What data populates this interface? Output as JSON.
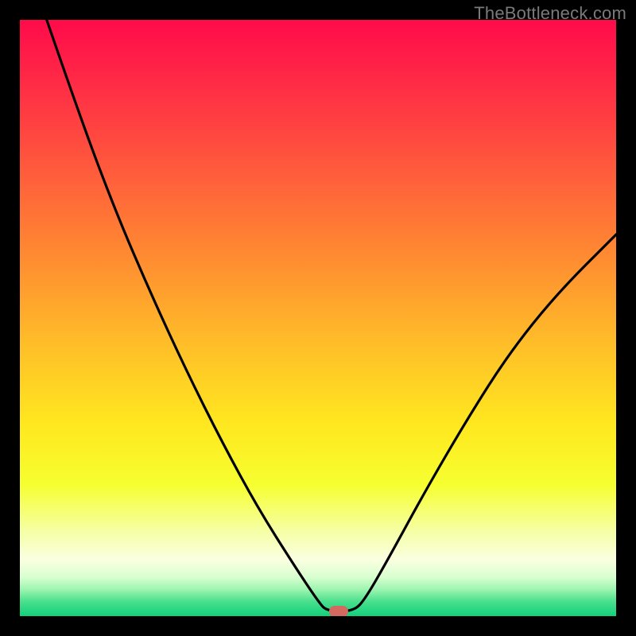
{
  "watermark": "TheBottleneck.com",
  "marker": {
    "color": "#d46a5f",
    "x_pct": 53.5,
    "y_pct": 99.2
  },
  "gradient_stops": [
    {
      "offset": 0,
      "color": "#ff0b4a"
    },
    {
      "offset": 0.1,
      "color": "#ff2946"
    },
    {
      "offset": 0.25,
      "color": "#ff5a3c"
    },
    {
      "offset": 0.4,
      "color": "#ff8c31"
    },
    {
      "offset": 0.55,
      "color": "#ffc028"
    },
    {
      "offset": 0.68,
      "color": "#ffe81f"
    },
    {
      "offset": 0.78,
      "color": "#f6ff30"
    },
    {
      "offset": 0.86,
      "color": "#f6ffa8"
    },
    {
      "offset": 0.905,
      "color": "#faffe0"
    },
    {
      "offset": 0.935,
      "color": "#d8ffd0"
    },
    {
      "offset": 0.955,
      "color": "#9ef5b0"
    },
    {
      "offset": 0.975,
      "color": "#4be08e"
    },
    {
      "offset": 1.0,
      "color": "#12d07a"
    }
  ],
  "chart_data": {
    "type": "line",
    "title": "",
    "xlabel": "",
    "ylabel": "",
    "xlim": [
      0,
      100
    ],
    "ylim": [
      0,
      100
    ],
    "note": "y axis is inverted visually (0 at top, 100 at bottom). Values below are percentages of plot width (x) and plot height from top (y).",
    "series": [
      {
        "name": "bottleneck-curve",
        "points": [
          {
            "x": 4.5,
            "y": 0.0
          },
          {
            "x": 10.0,
            "y": 16.0
          },
          {
            "x": 16.0,
            "y": 32.0
          },
          {
            "x": 22.0,
            "y": 46.0
          },
          {
            "x": 28.0,
            "y": 59.0
          },
          {
            "x": 34.0,
            "y": 71.0
          },
          {
            "x": 40.0,
            "y": 82.0
          },
          {
            "x": 46.0,
            "y": 91.5
          },
          {
            "x": 50.0,
            "y": 97.5
          },
          {
            "x": 51.5,
            "y": 99.2
          },
          {
            "x": 56.0,
            "y": 99.2
          },
          {
            "x": 58.0,
            "y": 97.0
          },
          {
            "x": 62.0,
            "y": 90.0
          },
          {
            "x": 68.0,
            "y": 79.0
          },
          {
            "x": 75.0,
            "y": 67.0
          },
          {
            "x": 82.0,
            "y": 56.0
          },
          {
            "x": 90.0,
            "y": 46.0
          },
          {
            "x": 100.0,
            "y": 36.0
          }
        ]
      }
    ],
    "marker": {
      "x": 53.5,
      "y": 99.2
    }
  }
}
